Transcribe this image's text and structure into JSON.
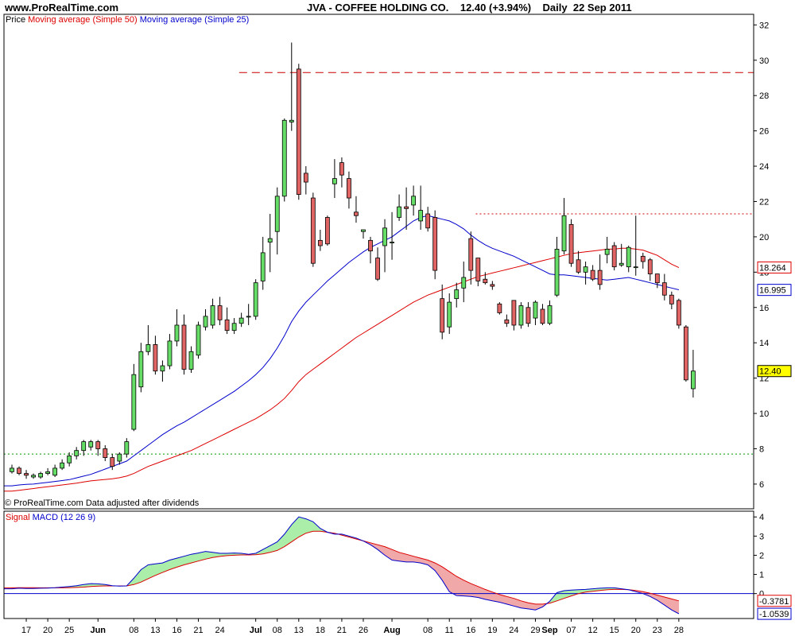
{
  "header": {
    "site": "www.ProRealTime.com",
    "title": "JVA - COFFEE HOLDING CO.    12.40 (+3.94%)    Daily  22 Sep 2011"
  },
  "legend": {
    "price_label": "Price",
    "ma50_label": "Moving average (Simple 50)",
    "ma25_label": "Moving average (Simple 25)",
    "signal_label": "Signal",
    "macd_label": "MACD (12 26 9)"
  },
  "footer": {
    "copyright": "© ProRealTime.com  Data adjusted after dividends"
  },
  "colors": {
    "up": "#66dd66",
    "down": "#e06464",
    "ma50": "#dd0000",
    "ma25": "#0000cc",
    "macd_fill_up": "#aaeeaa",
    "macd_fill_down": "#f0a8a8"
  },
  "chart_data": [
    {
      "type": "candlestick",
      "title": "JVA - COFFEE HOLDING CO.",
      "ylim": [
        4.6,
        32.6
      ],
      "yticks": [
        6,
        8,
        10,
        12,
        14,
        16,
        18,
        20,
        22,
        24,
        26,
        28,
        30,
        32
      ],
      "grid": false,
      "x_labels": [
        {
          "label": "17",
          "i": 2
        },
        {
          "label": "20",
          "i": 5
        },
        {
          "label": "25",
          "i": 8
        },
        {
          "label": "Jun",
          "i": 12
        },
        {
          "label": "08",
          "i": 17
        },
        {
          "label": "13",
          "i": 20
        },
        {
          "label": "16",
          "i": 23
        },
        {
          "label": "21",
          "i": 26
        },
        {
          "label": "24",
          "i": 29
        },
        {
          "label": "Jul",
          "i": 34
        },
        {
          "label": "08",
          "i": 37
        },
        {
          "label": "13",
          "i": 40
        },
        {
          "label": "18",
          "i": 43
        },
        {
          "label": "21",
          "i": 46
        },
        {
          "label": "26",
          "i": 49
        },
        {
          "label": "Aug",
          "i": 53
        },
        {
          "label": "08",
          "i": 58
        },
        {
          "label": "11",
          "i": 61
        },
        {
          "label": "16",
          "i": 64
        },
        {
          "label": "19",
          "i": 67
        },
        {
          "label": "24",
          "i": 70
        },
        {
          "label": "29",
          "i": 73
        },
        {
          "label": "Sep",
          "i": 75
        },
        {
          "label": "07",
          "i": 78
        },
        {
          "label": "12",
          "i": 81
        },
        {
          "label": "15",
          "i": 84
        },
        {
          "label": "20",
          "i": 87
        },
        {
          "label": "23",
          "i": 90
        },
        {
          "label": "28",
          "i": 93
        }
      ],
      "candles": [
        [
          6.7,
          6.9,
          6.6,
          7.1
        ],
        [
          6.9,
          6.6,
          6.5,
          7.0
        ],
        [
          6.6,
          6.5,
          6.3,
          6.8
        ],
        [
          6.4,
          6.5,
          6.3,
          6.6
        ],
        [
          6.4,
          6.6,
          6.3,
          6.7
        ],
        [
          6.6,
          6.7,
          6.5,
          6.9
        ],
        [
          6.5,
          6.9,
          6.4,
          7.1
        ],
        [
          6.9,
          7.2,
          6.8,
          7.4
        ],
        [
          7.2,
          7.6,
          7.0,
          7.8
        ],
        [
          7.6,
          7.9,
          7.4,
          8.1
        ],
        [
          7.9,
          8.4,
          7.6,
          8.5
        ],
        [
          8.1,
          8.4,
          7.9,
          8.5
        ],
        [
          8.4,
          8.0,
          7.6,
          8.5
        ],
        [
          8.0,
          7.5,
          7.3,
          8.2
        ],
        [
          7.5,
          7.0,
          6.8,
          7.7
        ],
        [
          7.3,
          7.7,
          7.1,
          7.8
        ],
        [
          7.7,
          8.4,
          7.5,
          8.6
        ],
        [
          9.1,
          12.2,
          9.0,
          12.8
        ],
        [
          11.5,
          13.5,
          11.2,
          14.0
        ],
        [
          13.5,
          13.9,
          13.3,
          15.0
        ],
        [
          13.9,
          12.4,
          12.2,
          14.4
        ],
        [
          12.4,
          12.7,
          11.8,
          13.0
        ],
        [
          12.7,
          14.1,
          12.5,
          14.5
        ],
        [
          14.1,
          15.0,
          13.8,
          15.9
        ],
        [
          15.0,
          12.5,
          12.2,
          15.6
        ],
        [
          12.5,
          13.5,
          12.3,
          13.8
        ],
        [
          13.3,
          15.0,
          13.1,
          15.2
        ],
        [
          14.9,
          15.5,
          14.7,
          15.9
        ],
        [
          15.0,
          16.1,
          14.8,
          16.5
        ],
        [
          16.1,
          15.3,
          15.0,
          16.6
        ],
        [
          15.3,
          14.7,
          14.5,
          16.0
        ],
        [
          14.7,
          15.1,
          14.5,
          15.4
        ],
        [
          15.1,
          15.4,
          14.9,
          15.7
        ],
        [
          15.5,
          15.5,
          15.0,
          16.2
        ],
        [
          15.5,
          17.4,
          15.3,
          17.6
        ],
        [
          17.5,
          19.1,
          17.0,
          20.0
        ],
        [
          19.7,
          19.9,
          18.0,
          21.3
        ],
        [
          20.3,
          22.3,
          19.0,
          22.8
        ],
        [
          22.3,
          26.6,
          22.0,
          26.7
        ],
        [
          26.5,
          26.6,
          26.0,
          31.0
        ],
        [
          29.5,
          22.4,
          22.1,
          29.8
        ],
        [
          23.6,
          23.1,
          22.4,
          24.0
        ],
        [
          22.2,
          18.5,
          18.3,
          22.5
        ],
        [
          19.8,
          19.5,
          19.2,
          20.4
        ],
        [
          21.1,
          19.6,
          19.5,
          21.2
        ],
        [
          23.0,
          23.3,
          22.2,
          24.4
        ],
        [
          24.2,
          23.5,
          22.8,
          24.5
        ],
        [
          23.3,
          22.2,
          21.6,
          23.7
        ],
        [
          21.4,
          21.2,
          20.8,
          22.3
        ],
        [
          20.3,
          20.4,
          19.9,
          20.4
        ],
        [
          19.8,
          19.2,
          18.5,
          20.0
        ],
        [
          18.8,
          17.6,
          17.5,
          19.4
        ],
        [
          19.5,
          20.5,
          18.0,
          21.0
        ],
        [
          19.7,
          19.7,
          18.7,
          21.4
        ],
        [
          21.1,
          21.7,
          20.9,
          22.4
        ],
        [
          21.7,
          21.6,
          20.4,
          22.8
        ],
        [
          21.8,
          22.3,
          21.2,
          22.9
        ],
        [
          20.9,
          21.5,
          20.4,
          22.9
        ],
        [
          21.3,
          20.5,
          20.3,
          21.7
        ],
        [
          21.1,
          18.1,
          17.6,
          21.5
        ],
        [
          16.5,
          14.6,
          14.2,
          17.3
        ],
        [
          14.9,
          16.3,
          14.5,
          16.8
        ],
        [
          16.5,
          17.0,
          16.0,
          17.4
        ],
        [
          17.1,
          17.7,
          16.3,
          18.6
        ],
        [
          19.9,
          18.1,
          17.3,
          20.3
        ],
        [
          18.8,
          17.5,
          17.2,
          18.8
        ],
        [
          17.6,
          17.4,
          17.3,
          18.0
        ],
        [
          17.3,
          17.2,
          17.0,
          17.5
        ],
        [
          16.2,
          15.7,
          15.6,
          16.3
        ],
        [
          15.3,
          15.1,
          14.9,
          15.6
        ],
        [
          16.4,
          15.0,
          14.7,
          16.4
        ],
        [
          15.0,
          16.1,
          14.8,
          16.3
        ],
        [
          16.0,
          15.1,
          14.9,
          16.3
        ],
        [
          15.4,
          16.3,
          15.0,
          16.4
        ],
        [
          15.9,
          15.1,
          15.0,
          16.2
        ],
        [
          15.1,
          16.1,
          15.0,
          16.4
        ],
        [
          16.7,
          19.3,
          16.6,
          20.0
        ],
        [
          19.2,
          21.2,
          19.0,
          22.2
        ],
        [
          20.7,
          18.5,
          18.3,
          21.0
        ],
        [
          18.7,
          18.0,
          17.9,
          19.2
        ],
        [
          18.0,
          18.3,
          17.3,
          18.6
        ],
        [
          18.1,
          17.6,
          17.5,
          18.4
        ],
        [
          18.1,
          17.3,
          17.0,
          19.0
        ],
        [
          19.0,
          19.3,
          18.5,
          20.0
        ],
        [
          19.5,
          18.3,
          18.1,
          19.7
        ],
        [
          18.4,
          18.5,
          18.3,
          19.6
        ],
        [
          18.3,
          19.4,
          18.0,
          19.5
        ],
        [
          18.3,
          18.3,
          17.8,
          21.2
        ],
        [
          18.9,
          18.6,
          18.2,
          19.1
        ],
        [
          18.7,
          17.9,
          17.5,
          18.8
        ],
        [
          17.9,
          17.4,
          17.1,
          17.9
        ],
        [
          17.4,
          16.7,
          16.4,
          17.9
        ],
        [
          16.7,
          16.2,
          15.9,
          16.9
        ],
        [
          16.4,
          15.0,
          14.8,
          16.5
        ],
        [
          14.9,
          11.9,
          11.8,
          15.0
        ],
        [
          11.4,
          12.4,
          10.9,
          13.6
        ]
      ],
      "ma50": [
        5.6,
        5.65,
        5.7,
        5.75,
        5.8,
        5.85,
        5.9,
        5.95,
        6.0,
        6.05,
        6.12,
        6.18,
        6.22,
        6.26,
        6.3,
        6.36,
        6.45,
        6.6,
        6.8,
        7.0,
        7.15,
        7.3,
        7.45,
        7.6,
        7.75,
        7.9,
        8.1,
        8.3,
        8.5,
        8.7,
        8.9,
        9.1,
        9.3,
        9.5,
        9.7,
        9.95,
        10.2,
        10.5,
        10.85,
        11.3,
        11.8,
        12.2,
        12.5,
        12.8,
        13.1,
        13.4,
        13.7,
        14.0,
        14.3,
        14.55,
        14.8,
        15.05,
        15.3,
        15.55,
        15.8,
        16.05,
        16.3,
        16.5,
        16.7,
        16.85,
        17.0,
        17.15,
        17.3,
        17.45,
        17.6,
        17.75,
        17.85,
        17.95,
        18.05,
        18.15,
        18.25,
        18.35,
        18.45,
        18.55,
        18.65,
        18.75,
        18.85,
        18.95,
        19.05,
        19.1,
        19.15,
        19.2,
        19.25,
        19.3,
        19.3,
        19.35,
        19.35,
        19.3,
        19.25,
        19.1,
        18.95,
        18.7,
        18.45,
        18.26
      ],
      "ma25": [
        5.9,
        5.95,
        5.98,
        6.0,
        6.05,
        6.1,
        6.15,
        6.2,
        6.25,
        6.35,
        6.45,
        6.55,
        6.7,
        6.85,
        7.0,
        7.15,
        7.3,
        7.6,
        7.9,
        8.2,
        8.5,
        8.8,
        9.05,
        9.3,
        9.5,
        9.75,
        10.0,
        10.25,
        10.5,
        10.75,
        11.0,
        11.25,
        11.55,
        11.85,
        12.2,
        12.6,
        13.1,
        13.7,
        14.4,
        15.2,
        15.8,
        16.3,
        16.7,
        17.1,
        17.5,
        17.85,
        18.2,
        18.55,
        18.85,
        19.15,
        19.4,
        19.6,
        19.8,
        20.0,
        20.3,
        20.6,
        20.9,
        21.1,
        21.2,
        21.1,
        21.0,
        20.9,
        20.7,
        20.45,
        20.1,
        19.8,
        19.55,
        19.35,
        19.2,
        19.05,
        18.9,
        18.7,
        18.5,
        18.3,
        18.1,
        17.9,
        17.85,
        17.85,
        17.8,
        17.75,
        17.7,
        17.65,
        17.6,
        17.55,
        17.6,
        17.65,
        17.7,
        17.6,
        17.5,
        17.4,
        17.3,
        17.2,
        17.1,
        17.0
      ],
      "hlines": [
        {
          "y": 29.3,
          "x_from_i": 40,
          "color": "#cc0000",
          "dash": "long"
        },
        {
          "y": 21.3,
          "x_from_i": 73,
          "color": "#cc0000",
          "dash": "short"
        },
        {
          "y": 7.7,
          "x_from_i": 0,
          "color": "#009900",
          "dash": "short"
        }
      ],
      "last_labels": [
        {
          "value": "18.264",
          "y": 18.264,
          "border": "#dd0000"
        },
        {
          "value": "16.995",
          "y": 16.995,
          "border": "#0000cc"
        },
        {
          "value": "12.40",
          "y": 12.4,
          "border": "#000000",
          "bg": "#ffff00"
        }
      ]
    },
    {
      "type": "line",
      "title": "MACD (12 26 9)",
      "ylim": [
        -1.3,
        4.3
      ],
      "yticks": [
        0,
        1,
        2,
        3,
        4
      ],
      "zero_line": 0,
      "macd": [
        0.25,
        0.28,
        0.27,
        0.27,
        0.28,
        0.29,
        0.31,
        0.34,
        0.37,
        0.41,
        0.47,
        0.52,
        0.51,
        0.47,
        0.41,
        0.39,
        0.4,
        0.8,
        1.25,
        1.5,
        1.55,
        1.6,
        1.75,
        1.85,
        1.95,
        2.05,
        2.12,
        2.2,
        2.15,
        2.1,
        2.1,
        2.12,
        2.1,
        2.05,
        2.1,
        2.3,
        2.5,
        2.7,
        3.1,
        3.6,
        4.0,
        3.9,
        3.75,
        3.4,
        3.2,
        3.1,
        3.1,
        3.0,
        2.9,
        2.75,
        2.55,
        2.3,
        2.0,
        1.75,
        1.7,
        1.65,
        1.65,
        1.6,
        1.5,
        1.2,
        0.7,
        0.1,
        -0.1,
        -0.12,
        -0.15,
        -0.2,
        -0.3,
        -0.38,
        -0.45,
        -0.55,
        -0.65,
        -0.75,
        -0.8,
        -0.85,
        -0.7,
        -0.4,
        0.05,
        0.15,
        0.18,
        0.2,
        0.22,
        0.25,
        0.28,
        0.3,
        0.3,
        0.25,
        0.2,
        0.1,
        0.0,
        -0.15,
        -0.35,
        -0.6,
        -0.85,
        -1.05
      ],
      "signal": [
        0.3,
        0.31,
        0.31,
        0.31,
        0.3,
        0.3,
        0.3,
        0.3,
        0.31,
        0.32,
        0.34,
        0.37,
        0.39,
        0.4,
        0.4,
        0.4,
        0.4,
        0.47,
        0.6,
        0.78,
        0.95,
        1.1,
        1.25,
        1.38,
        1.5,
        1.6,
        1.7,
        1.8,
        1.88,
        1.94,
        1.98,
        2.0,
        2.02,
        2.02,
        2.03,
        2.07,
        2.15,
        2.25,
        2.45,
        2.7,
        2.95,
        3.15,
        3.25,
        3.25,
        3.2,
        3.15,
        3.05,
        2.95,
        2.85,
        2.75,
        2.65,
        2.55,
        2.45,
        2.3,
        2.15,
        2.05,
        1.95,
        1.85,
        1.75,
        1.6,
        1.4,
        1.15,
        0.9,
        0.7,
        0.52,
        0.37,
        0.22,
        0.08,
        -0.05,
        -0.15,
        -0.25,
        -0.38,
        -0.48,
        -0.55,
        -0.55,
        -0.5,
        -0.38,
        -0.25,
        -0.12,
        0.0,
        0.08,
        0.12,
        0.16,
        0.2,
        0.22,
        0.22,
        0.2,
        0.16,
        0.1,
        0.02,
        -0.08,
        -0.18,
        -0.28,
        -0.38
      ],
      "last_labels": [
        {
          "value": "-0.3781",
          "y": -0.378,
          "border": "#dd0000"
        },
        {
          "value": "-1.0539",
          "y": -1.054,
          "border": "#0000cc"
        }
      ]
    }
  ]
}
